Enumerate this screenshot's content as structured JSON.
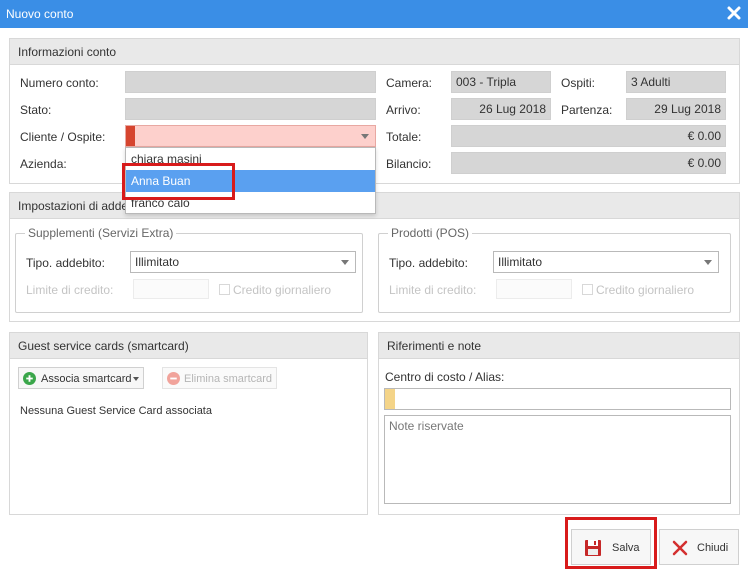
{
  "window": {
    "title": "Nuovo conto"
  },
  "info": {
    "header": "Informazioni conto",
    "numero_label": "Numero conto:",
    "stato_label": "Stato:",
    "cliente_label": "Cliente / Ospite:",
    "azienda_label": "Azienda:",
    "camera_label": "Camera:",
    "camera_value": "003 - Tripla",
    "ospiti_label": "Ospiti:",
    "ospiti_value": "3 Adulti",
    "arrivo_label": "Arrivo:",
    "arrivo_value": "26 Lug 2018",
    "partenza_label": "Partenza:",
    "partenza_value": "29 Lug 2018",
    "totale_label": "Totale:",
    "totale_value": "€ 0.00",
    "bilancio_label": "Bilancio:",
    "bilancio_value": "€ 0.00"
  },
  "cliente_dropdown": {
    "options": [
      "chiara masini",
      "Anna Buan",
      "franco calo"
    ],
    "selected_index": 1
  },
  "impostazioni": {
    "header": "Impostazioni di addebito",
    "supplementi": {
      "legend": "Supplementi (Servizi Extra)",
      "tipo_label": "Tipo. addebito:",
      "tipo_value": "Illimitato",
      "limite_label": "Limite di credito:",
      "credito_label": "Credito giornaliero"
    },
    "prodotti": {
      "legend": "Prodotti (POS)",
      "tipo_label": "Tipo. addebito:",
      "tipo_value": "Illimitato",
      "limite_label": "Limite di credito:",
      "credito_label": "Credito giornaliero"
    }
  },
  "smartcard": {
    "header": "Guest service cards (smartcard)",
    "associa_label": "Associa smartcard",
    "elimina_label": "Elimina smartcard",
    "empty_text": "Nessuna Guest Service Card associata"
  },
  "riferimenti": {
    "header": "Riferimenti e note",
    "centro_label": "Centro di costo / Alias:",
    "note_placeholder": "Note riservate"
  },
  "footer": {
    "save_label": "Salva",
    "close_label": "Chiudi"
  },
  "colors": {
    "titlebar": "#3a8ee6",
    "highlight": "#d81b1b",
    "selected_option": "#5aa0f0",
    "required_field": "#fdd0cc"
  }
}
